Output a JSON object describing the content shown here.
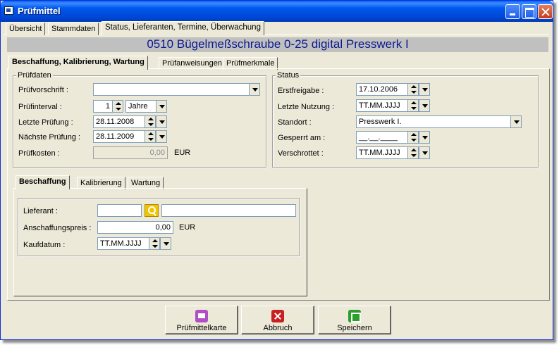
{
  "window": {
    "title": "Prüfmittel"
  },
  "top_tabs": [
    "Übersicht",
    "Stammdaten",
    "Status, Lieferanten, Termine, Überwachung"
  ],
  "header": "0510 Bügelmeßschraube 0-25 digital Presswerk I",
  "sub_tabs": [
    "Beschaffung, Kalibrierung, Wartung",
    "Prüfanweisungen",
    "Prüfmerkmale"
  ],
  "pruefdaten": {
    "title": "Prüfdaten",
    "vorschrift_label": "Prüfvorschrift :",
    "vorschrift_value": "",
    "interval_label": "Prüfinterval :",
    "interval_value": "1",
    "interval_unit": "Jahre",
    "letzte_label": "Letzte Prüfung :",
    "letzte_value": "28.11.2008",
    "naechste_label": "Nächste Prüfung :",
    "naechste_value": "28.11.2009",
    "kosten_label": "Prüfkosten :",
    "kosten_value": "0,00",
    "kosten_unit": "EUR"
  },
  "status": {
    "title": "Status",
    "erstfreigabe_label": "Erstfreigabe :",
    "erstfreigabe_value": "17.10.2006",
    "letzte_nutzung_label": "Letzte Nutzung :",
    "letzte_nutzung_value": "TT.MM.JJJJ",
    "standort_label": "Standort :",
    "standort_value": "Presswerk  I.",
    "gesperrt_label": "Gesperrt am :",
    "gesperrt_value": "__.__.____",
    "verschrottet_label": "Verschrottet :",
    "verschrottet_value": "TT.MM.JJJJ"
  },
  "inner_tabs": [
    "Beschaffung",
    "Kalibrierung",
    "Wartung"
  ],
  "beschaffung": {
    "lieferant_label": "Lieferant :",
    "lieferant_code": "",
    "lieferant_name": "",
    "preis_label": "Anschaffungspreis :",
    "preis_value": "0,00",
    "preis_unit": "EUR",
    "kaufdatum_label": "Kaufdatum :",
    "kaufdatum_value": "TT.MM.JJJJ"
  },
  "buttons": {
    "print": "Prüfmittelkarte",
    "cancel": "Abbruch",
    "save": "Speichern"
  }
}
